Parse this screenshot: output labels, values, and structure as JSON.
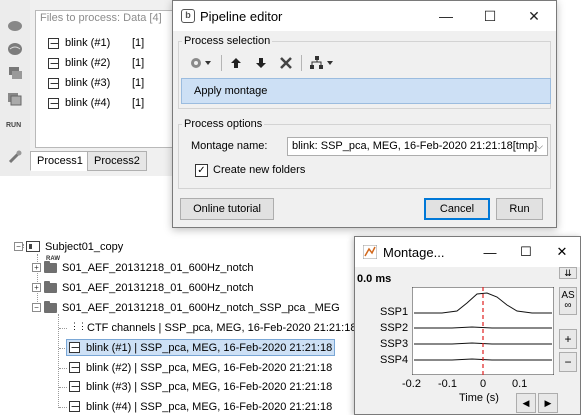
{
  "files_panel": {
    "title": "Files to process: Data [4]",
    "files": [
      {
        "name": "blink (#1)",
        "count": "[1]"
      },
      {
        "name": "blink (#2)",
        "count": "[1]"
      },
      {
        "name": "blink (#3)",
        "count": "[1]"
      },
      {
        "name": "blink (#4)",
        "count": "[1]"
      }
    ],
    "tabs": [
      "Process1",
      "Process2"
    ],
    "run_label": "RUN"
  },
  "pipeline_editor": {
    "title": "Pipeline editor",
    "process_selection_label": "Process selection",
    "selected_process": "Apply montage",
    "process_options_label": "Process options",
    "montage_name_label": "Montage name:",
    "montage_name_value": "blink: SSP_pca, MEG, 16-Feb-2020 21:21:18[tmp]",
    "create_folders_label": "Create new folders",
    "create_folders_checked": true,
    "online_tutorial_label": "Online tutorial",
    "cancel_label": "Cancel",
    "run_label": "Run",
    "toolbar_icons": [
      "gear-icon",
      "arrow-up-icon",
      "arrow-down-icon",
      "delete-icon",
      "pipeline-tree-icon"
    ]
  },
  "tree": {
    "subject": "Subject01_copy",
    "folders": [
      "S01_AEF_20131218_01_600Hz_notch",
      "S01_AEF_20131218_01_600Hz_notch",
      "S01_AEF_20131218_01_600Hz_notch_SSP_pca _MEG"
    ],
    "raw_badge": "RAW",
    "channels": "CTF channels  | SSP_pca, MEG, 16-Feb-2020 21:21:18",
    "items": [
      "blink (#1) | SSP_pca, MEG, 16-Feb-2020 21:21:18",
      "blink (#2) | SSP_pca, MEG, 16-Feb-2020 21:21:18",
      "blink (#3) | SSP_pca, MEG, 16-Feb-2020 21:21:18",
      "blink (#4) | SSP_pca, MEG, 16-Feb-2020 21:21:18"
    ]
  },
  "montage_window": {
    "title": "Montage...",
    "time_readout": "0.0 ms",
    "channels": [
      "SSP1",
      "SSP2",
      "SSP3",
      "SSP4"
    ],
    "x_ticks": [
      "-0.2",
      "-0.1",
      "0",
      "0.1"
    ],
    "x_label": "Time (s)",
    "as_label": "AS",
    "inf_label": "∞",
    "plus_label": "+",
    "minus_label": "−",
    "prev_label": "◀",
    "next_label": "▶",
    "cursor_color": "#e02020"
  }
}
